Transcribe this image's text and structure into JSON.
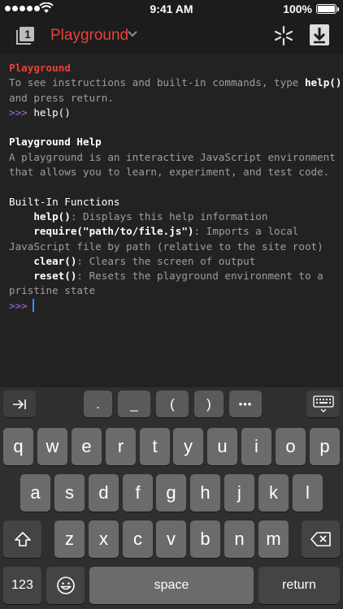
{
  "status_bar": {
    "time": "9:41 AM",
    "battery_percent": "100%",
    "battery_level": 1.0
  },
  "nav_bar": {
    "tab_count": "1",
    "title": "Playground"
  },
  "console": {
    "intro_title": "Playground",
    "intro_line1_pre": "To see instructions and built-in commands, type ",
    "intro_line1_cmd": "help()",
    "intro_line2": "and press return.",
    "prompt_symbol": ">>>",
    "entered_command": "help()",
    "help_title": "Playground Help",
    "help_desc_line1": "A playground is an interactive JavaScript environment",
    "help_desc_line2": "that allows you to learn, experiment, and test code.",
    "builtin_heading": "Built-In Functions",
    "functions": [
      {
        "name": "help()",
        "desc": ": Displays this help information"
      },
      {
        "name": "require(\"path/to/file.js\")",
        "desc": ": Imports a local",
        "cont": "JavaScript file by path (relative to the site root)"
      },
      {
        "name": "clear()",
        "desc": ": Clears the screen of output"
      },
      {
        "name": "reset()",
        "desc": ": Resets the playground environment to a",
        "cont": "pristine state"
      }
    ]
  },
  "accessory_bar": {
    "tab_key_icon": "tab-arrow-icon",
    "keys": [
      ".",
      "_",
      "(",
      ")"
    ],
    "more_label": "•••",
    "hide_keyboard_icon": "keyboard-hide-icon"
  },
  "keyboard": {
    "row1": [
      "q",
      "w",
      "e",
      "r",
      "t",
      "y",
      "u",
      "i",
      "o",
      "p"
    ],
    "row2": [
      "a",
      "s",
      "d",
      "f",
      "g",
      "h",
      "j",
      "k",
      "l"
    ],
    "row3": [
      "z",
      "x",
      "c",
      "v",
      "b",
      "n",
      "m"
    ],
    "numbers_label": "123",
    "space_label": "space",
    "return_label": "return",
    "shift_icon": "shift-icon",
    "delete_icon": "delete-icon",
    "emoji_icon": "emoji-icon"
  },
  "colors": {
    "accent": "#e8413f",
    "prompt": "#a16cd6",
    "cursor": "#3d8bff",
    "background": "#222222"
  }
}
